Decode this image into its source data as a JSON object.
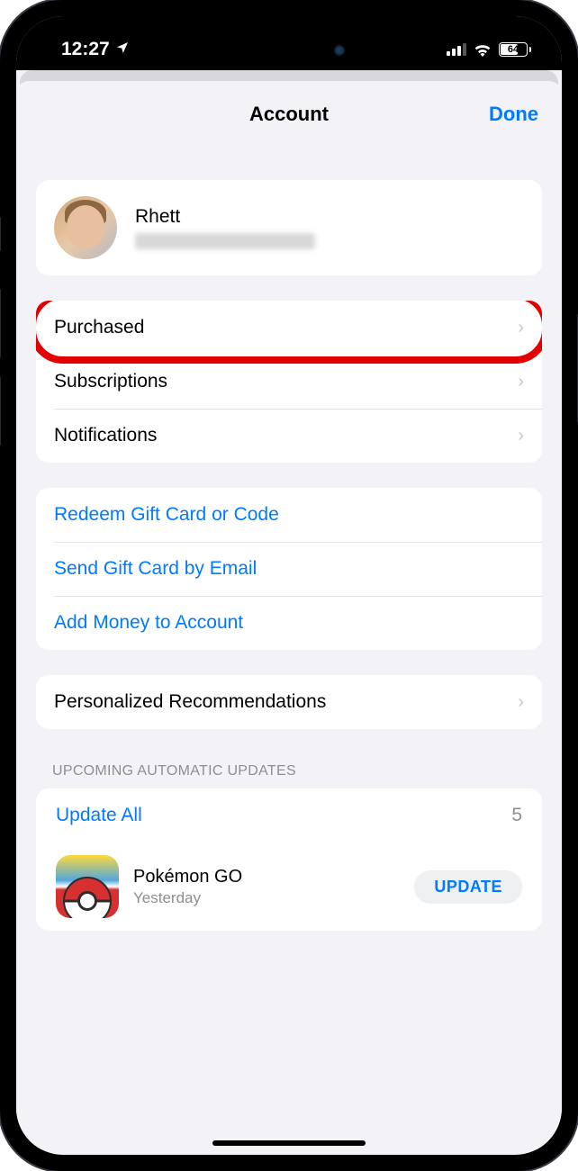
{
  "status": {
    "time": "12:27",
    "battery": "64"
  },
  "header": {
    "title": "Account",
    "done": "Done"
  },
  "profile": {
    "name": "Rhett"
  },
  "menu1": {
    "purchased": "Purchased",
    "subscriptions": "Subscriptions",
    "notifications": "Notifications"
  },
  "menu2": {
    "redeem": "Redeem Gift Card or Code",
    "sendgift": "Send Gift Card by Email",
    "addmoney": "Add Money to Account"
  },
  "menu3": {
    "personalized": "Personalized Recommendations"
  },
  "updates": {
    "header": "UPCOMING AUTOMATIC UPDATES",
    "updateAll": "Update All",
    "count": "5",
    "app": {
      "name": "Pokémon GO",
      "time": "Yesterday",
      "button": "UPDATE"
    }
  }
}
